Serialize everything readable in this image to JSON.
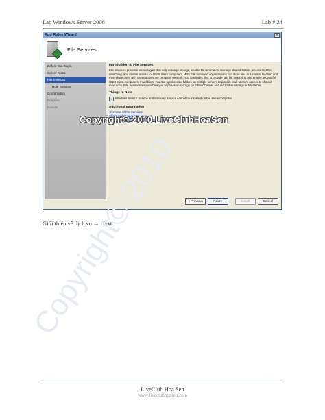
{
  "page": {
    "header_left": "Lab Windows Server 2008",
    "header_right": "Lab # 24",
    "caption": "Giới thiệu về dịch vụ → Next",
    "footer": "LiveClub Hoa Sen",
    "footer_sub": "www.liveclubhoasen.com",
    "overlay_watermark": "Copyright© 2010 LiveClubHoaSen",
    "diagonal_watermark": "Copyright© 2010"
  },
  "wizard": {
    "title": "Add Roles Wizard",
    "close_glyph": "x",
    "banner_title": "File Services",
    "nav": [
      {
        "label": "Before You Begin",
        "state": "normal",
        "sub": false
      },
      {
        "label": "Server Roles",
        "state": "normal",
        "sub": false
      },
      {
        "label": "File Services",
        "state": "selected",
        "sub": false
      },
      {
        "label": "Role Services",
        "state": "normal",
        "sub": true
      },
      {
        "label": "Confirmation",
        "state": "normal",
        "sub": false
      },
      {
        "label": "Progress",
        "state": "disabled",
        "sub": false
      },
      {
        "label": "Results",
        "state": "disabled",
        "sub": false
      }
    ],
    "intro_heading": "Introduction to File Services",
    "intro_text": "File Services provides technologies that help manage storage, enable file replication, manage shared folders, ensure fast file searching, and enable access for UNIX client computers. With File Services, organizations can store files in a central location and then share them with users across the company network. You can index files to provide fast file searching and enable access for UNIX client computers. In addition, you can synchronize folders on multiple servers to provide fault-tolerant access to shared resources. File Services also enables you to provision storage on Fibre Channel and iSCSI disk storage subsystems.",
    "notes_heading": "Things to Note",
    "note_text": "Windows Search Service and Indexing Service cannot be installed on the same computer.",
    "additional_heading": "Additional Information",
    "links": [
      "Overview of File Services",
      "Share and Storage Management",
      "Distributed File System Management"
    ],
    "buttons": {
      "previous": "< Previous",
      "next": "Next >",
      "install": "Install",
      "cancel": "Cancel"
    }
  }
}
